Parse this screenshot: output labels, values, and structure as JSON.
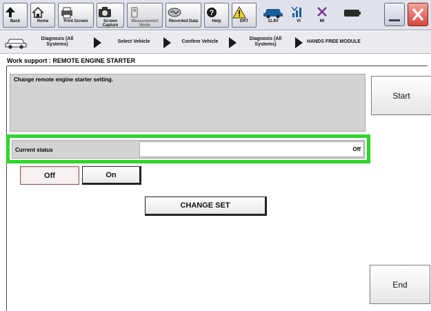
{
  "toolbar": {
    "buttons": [
      {
        "label": "Back",
        "icon": "back-arrow-icon"
      },
      {
        "label": "Home",
        "icon": "home-icon"
      },
      {
        "label": "Print Screen",
        "icon": "printer-icon"
      },
      {
        "label": "Screen Capture",
        "icon": "camera-icon"
      },
      {
        "label": "Measurement Mode",
        "icon": "measurement-icon"
      },
      {
        "label": "Recorded Data",
        "icon": "recorded-data-icon"
      },
      {
        "label": "Help",
        "icon": "help-icon"
      },
      {
        "label": "ERT",
        "icon": "warning-icon"
      }
    ],
    "status": {
      "battery_voltage": "11.8V",
      "vi_label": "VI",
      "mi_label": "MI"
    }
  },
  "breadcrumbs": [
    "Diagnosis (All Systems)",
    "Select Vehicle",
    "Confirm Vehicle",
    "Diagnosis (All Systems)",
    "HANDS FREE MODULE"
  ],
  "work_support": {
    "title": "Work support : REMOTE ENGINE STARTER",
    "description": "Change remote engine starter setting.",
    "start_label": "Start",
    "current_status_label": "Current status",
    "current_status_value": "Off",
    "off_label": "Off",
    "on_label": "On",
    "change_set_label": "CHANGE SET",
    "end_label": "End"
  },
  "colors": {
    "highlight": "#2ed62a",
    "panel_gray": "#d3d3d3",
    "close_red": "#d8463a"
  }
}
